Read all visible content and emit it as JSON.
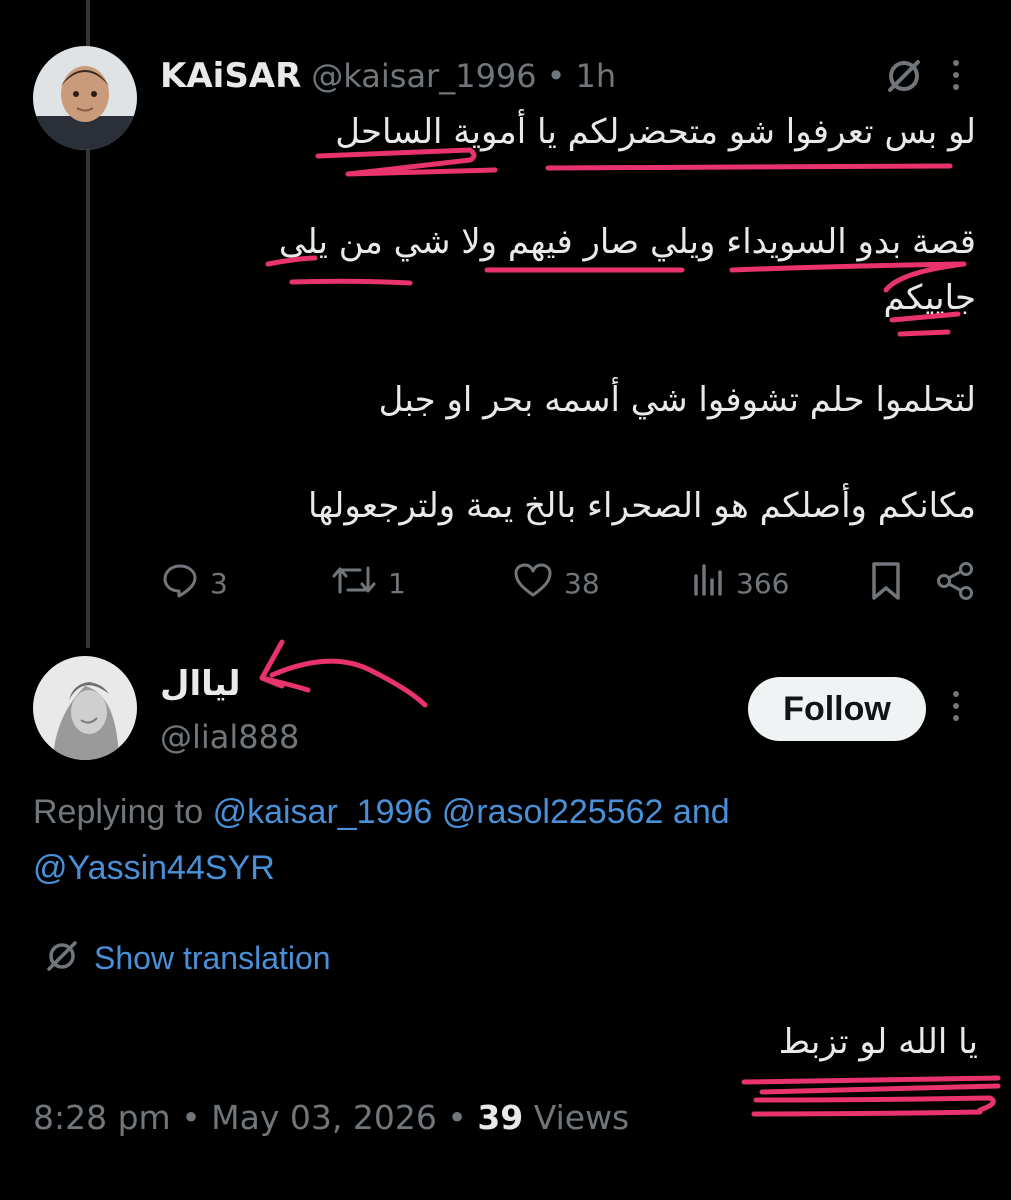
{
  "tweet": {
    "author_name": "KAiSAR",
    "author_handle": "@kaisar_1996",
    "separator": "•",
    "time_ago": "1h",
    "lines": [
      "لو بس تعرفوا شو متحضرلكم يا أموية الساحل",
      "قصة بدو السويداء ويلي صار فيهم ولا شي من يلي",
      "جاييكم",
      "لتحلموا حلم تشوفوا شي أسمه بحر او جبل",
      "مكانكم وأصلكم هو الصحراء بالخ يمة ولترجعولها"
    ],
    "stats": {
      "replies": "3",
      "retweets": "1",
      "likes": "38",
      "views": "366"
    }
  },
  "reply": {
    "author_name": "لياال",
    "author_handle": "@lial888",
    "follow_label": "Follow",
    "replying_to_label": "Replying to",
    "mention1": "@kaisar_1996",
    "mention2": "@rasol225562",
    "and_word": "and",
    "mention3": "@Yassin44SYR",
    "show_translation": "Show translation",
    "text": "يا الله لو تزبط",
    "timestamp": "8:28 pm",
    "date": "May 03, 2026",
    "separator": "•",
    "views_count": "39",
    "views_label": "Views"
  },
  "icons": {
    "grok": "grok-icon",
    "more": "more-icon",
    "reply": "reply-icon",
    "retweet": "retweet-icon",
    "like": "heart-icon",
    "views": "views-icon",
    "bookmark": "bookmark-icon",
    "share": "share-icon",
    "translate": "translate-icon"
  },
  "colors": {
    "background": "#000000",
    "text": "#e7e9ea",
    "muted": "#71767b",
    "link": "#4a90d9",
    "annotation": "#e8336d"
  }
}
